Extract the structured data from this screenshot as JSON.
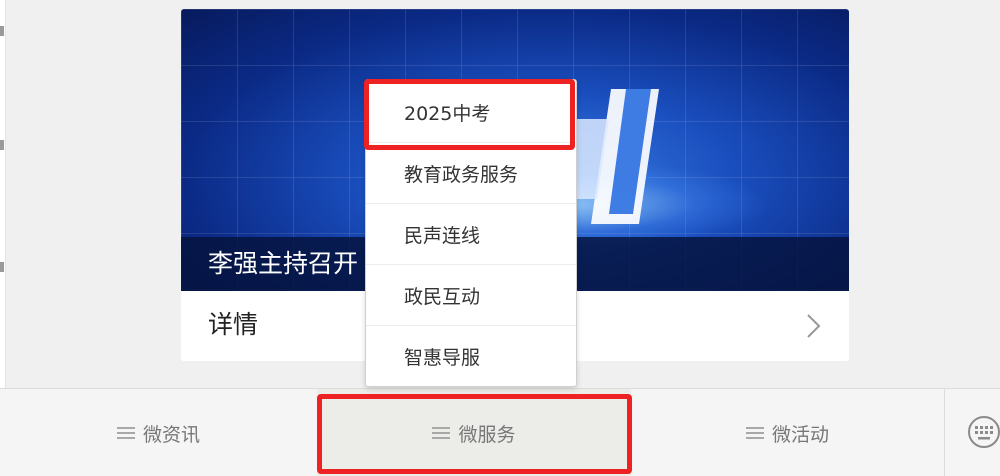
{
  "card": {
    "caption": "李强主持召开",
    "detail_label": "详情"
  },
  "popup": {
    "items": [
      {
        "label": "2025中考"
      },
      {
        "label": "教育政务服务"
      },
      {
        "label": "民声连线"
      },
      {
        "label": "政民互动"
      },
      {
        "label": "智惠导服"
      }
    ]
  },
  "menubar": {
    "items": [
      {
        "label": "微资讯"
      },
      {
        "label": "微服务"
      },
      {
        "label": "微活动"
      }
    ],
    "active_index": 1
  },
  "colors": {
    "highlight": "#ee2222",
    "banner_blue": "#1a4fbf",
    "menubar_bg": "#f5f5f5"
  },
  "icons": [
    "menu-lines-icon",
    "chevron-right-icon",
    "keyboard-icon"
  ]
}
